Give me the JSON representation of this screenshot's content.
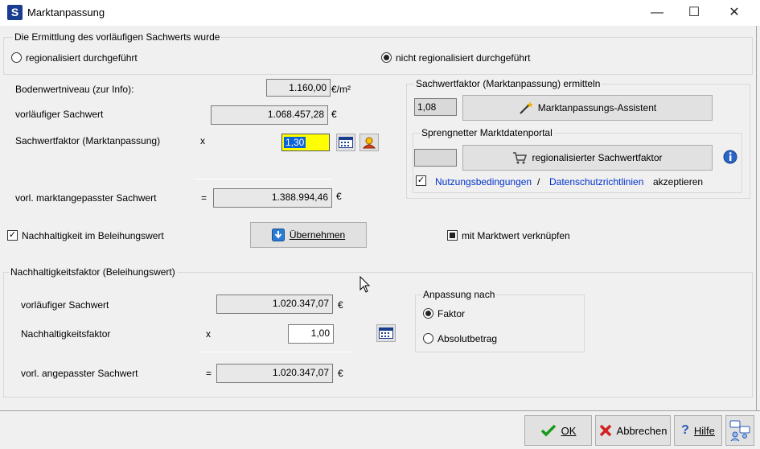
{
  "window": {
    "title": "Marktanpassung",
    "icon_letter": "S",
    "minimize": "—",
    "maximize": "☐",
    "close": "✕"
  },
  "ermittlung": {
    "legend": "Die Ermittlung des vorläufigen Sachwerts wurde",
    "option_regional": "regionalisiert durchgeführt",
    "option_nicht_regional": "nicht regionalisiert durchgeführt",
    "selected": "nicht_regional"
  },
  "werte": {
    "bodenwert_label": "Bodenwertniveau (zur Info):",
    "bodenwert_value": "1.160,00",
    "bodenwert_unit": "€/m²",
    "sachwert_label": "vorläufiger Sachwert",
    "sachwert_value": "1.068.457,28",
    "sachwert_unit": "€",
    "faktor_label": "Sachwertfaktor (Marktanpassung)",
    "faktor_op": "x",
    "faktor_value": "1,30",
    "angepasst_label": "vorl. marktangepasster Sachwert",
    "angepasst_op": "=",
    "angepasst_value": "1.388.994,46",
    "angepasst_unit": "€"
  },
  "ermitteln": {
    "legend": "Sachwertfaktor (Marktanpassung) ermitteln",
    "value": "1,08",
    "assistent_label": "Marktanpassungs-Assistent",
    "portal_legend": "Sprengnetter Marktdatenportal",
    "portal_value": "",
    "regional_button_label": "regionalisierter Sachwertfaktor",
    "nutzung_link": "Nutzungsbedingungen",
    "slash": "/",
    "datenschutz_link": "Datenschutzrichtlinien",
    "akzeptieren": "akzeptieren"
  },
  "nachhaltigkeit_check_label": "Nachhaltigkeit im Beleihungswert",
  "uebernehmen_label": "Übernehmen",
  "marktwert_check_label": "mit Marktwert verknüpfen",
  "nachhaltigkeit": {
    "legend": "Nachhaltigkeitsfaktor (Beleihungswert)",
    "sachwert_label": "vorläufiger Sachwert",
    "sachwert_value": "1.020.347,07",
    "sachwert_unit": "€",
    "faktor_label": "Nachhaltigkeitsfaktor",
    "faktor_op": "x",
    "faktor_value": "1,00",
    "angepasst_label": "vorl. angepasster Sachwert",
    "angepasst_op": "=",
    "angepasst_value": "1.020.347,07",
    "angepasst_unit": "€"
  },
  "anpassung": {
    "legend": "Anpassung nach",
    "option_faktor": "Faktor",
    "option_absolut": "Absolutbetrag",
    "selected": "faktor"
  },
  "footer": {
    "ok_label": "OK",
    "abbrechen_label": "Abbrechen",
    "hilfe_label": "Hilfe"
  },
  "colors": {
    "accent_blue": "#0a64d8",
    "link_blue": "#0033cc",
    "ok_green": "#1a9a1a",
    "cancel_red": "#d42020",
    "highlight_yellow": "#ffff00"
  }
}
